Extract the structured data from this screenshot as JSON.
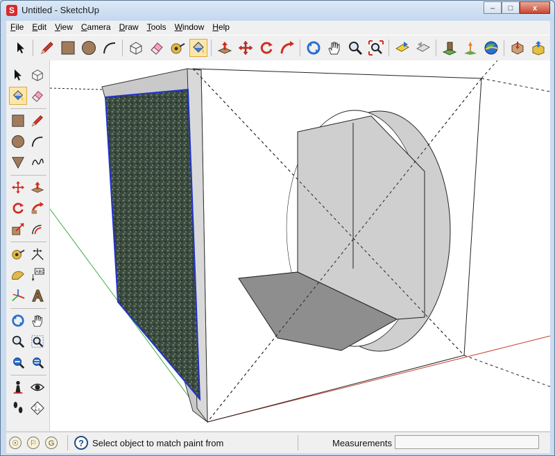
{
  "window": {
    "title": "Untitled - SketchUp",
    "app_icon": "sketchup-logo-icon"
  },
  "title_buttons": {
    "minimize": "–",
    "maximize": "□",
    "close": "x"
  },
  "menu": [
    {
      "underlined": "F",
      "rest": "ile"
    },
    {
      "underlined": "E",
      "rest": "dit"
    },
    {
      "underlined": "V",
      "rest": "iew"
    },
    {
      "underlined": "C",
      "rest": "amera"
    },
    {
      "underlined": "D",
      "rest": "raw"
    },
    {
      "underlined": "T",
      "rest": "ools"
    },
    {
      "underlined": "W",
      "rest": "indow"
    },
    {
      "underlined": "H",
      "rest": "elp"
    }
  ],
  "toolbar_top": {
    "tools": [
      "select",
      "pencil",
      "rectangle",
      "circle",
      "arc",
      "make-component",
      "eraser",
      "tape-measure",
      "paint-bucket",
      "push-pull",
      "move",
      "rotate",
      "follow-me",
      "orbit",
      "pan",
      "zoom",
      "zoom-extents",
      "previous-view",
      "next-view",
      "add-location",
      "toggle-terrain",
      "google-earth",
      "get-models",
      "share-model"
    ],
    "active": "paint-bucket"
  },
  "toolbar_left": {
    "tools": [
      "select",
      "make-component",
      "paint-bucket",
      "eraser",
      "rectangle",
      "line",
      "circle",
      "arc",
      "polygon",
      "freehand",
      "move",
      "push-pull",
      "rotate",
      "follow-me",
      "scale",
      "offset",
      "tape-measure",
      "dimension",
      "protractor",
      "text",
      "axes",
      "3d-text",
      "orbit",
      "pan",
      "zoom",
      "zoom-window",
      "zoom-extents",
      "previous",
      "position-camera",
      "look-around",
      "walk",
      "section-plane"
    ],
    "active": "paint-bucket"
  },
  "status": {
    "icons": [
      "geolocation-icon",
      "credits-icon",
      "google-sign-in-icon"
    ],
    "help_glyph": "?",
    "text": "Select object to match paint from",
    "measurements_label": "Measurements",
    "measurements_value": ""
  },
  "colors": {
    "selection_blue": "#2233cc",
    "green_axis": "#3fae3f",
    "red_axis": "#c0392b",
    "texture_dark": "#3a4a3d"
  }
}
